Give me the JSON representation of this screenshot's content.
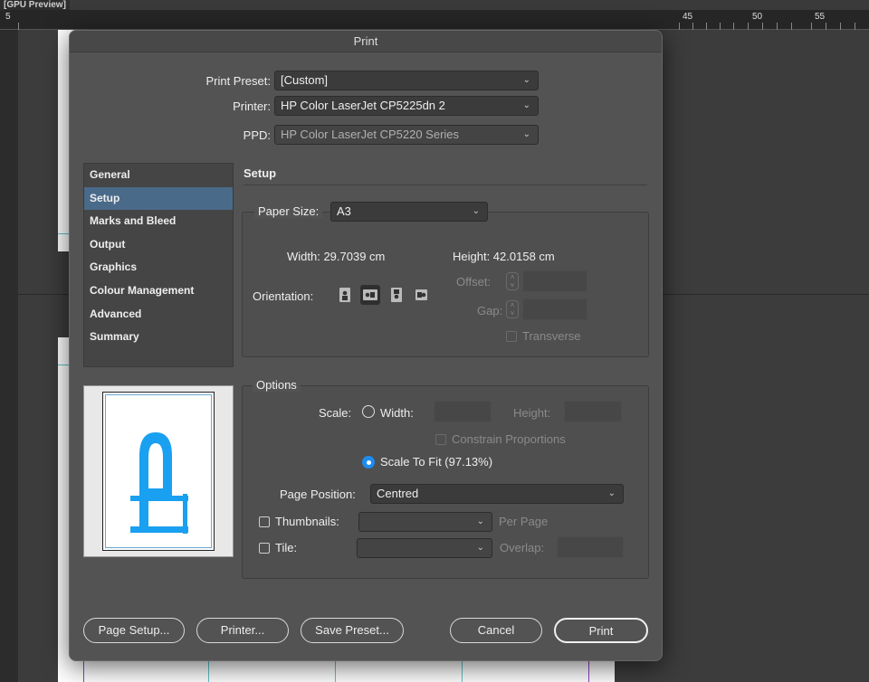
{
  "app": {
    "title": "[GPU Preview]",
    "ruler_labels": [
      "5",
      "45",
      "50",
      "55"
    ]
  },
  "dialog": {
    "title": "Print",
    "print_preset": {
      "label": "Print Preset:",
      "value": "[Custom]"
    },
    "printer": {
      "label": "Printer:",
      "value": "HP Color LaserJet CP5225dn 2"
    },
    "ppd": {
      "label": "PPD:",
      "value": "HP Color LaserJet CP5220 Series"
    },
    "sidebar": {
      "items": [
        {
          "label": "General",
          "selected": false
        },
        {
          "label": "Setup",
          "selected": true
        },
        {
          "label": "Marks and Bleed",
          "selected": false
        },
        {
          "label": "Output",
          "selected": false
        },
        {
          "label": "Graphics",
          "selected": false
        },
        {
          "label": "Colour Management",
          "selected": false
        },
        {
          "label": "Advanced",
          "selected": false
        },
        {
          "label": "Summary",
          "selected": false
        }
      ]
    },
    "preview": {
      "letter": "P",
      "letter_color": "#1aa0f0"
    },
    "setup": {
      "title": "Setup",
      "paper_size": {
        "label": "Paper Size:",
        "value": "A3"
      },
      "width": "Width: 29.7039 cm",
      "height": "Height: 42.0158 cm",
      "orientation": {
        "label": "Orientation:",
        "selected_index": 1
      },
      "offset_label": "Offset:",
      "gap_label": "Gap:",
      "transverse_label": "Transverse"
    },
    "options": {
      "title": "Options",
      "scale_label": "Scale:",
      "width_label": "Width:",
      "height_label": "Height:",
      "constrain_label": "Constrain Proportions",
      "scale_to_fit_label": "Scale To Fit (97.13%)",
      "page_position": {
        "label": "Page Position:",
        "value": "Centred"
      },
      "thumbnails_label": "Thumbnails:",
      "per_page_label": "Per Page",
      "tile_label": "Tile:",
      "overlap_label": "Overlap:"
    },
    "buttons": {
      "page_setup": "Page Setup...",
      "printer": "Printer...",
      "save_preset": "Save Preset...",
      "cancel": "Cancel",
      "print": "Print"
    }
  },
  "colors": {
    "accent": "#1d8cf0",
    "selected_sidebar": "#4a6a8a"
  }
}
